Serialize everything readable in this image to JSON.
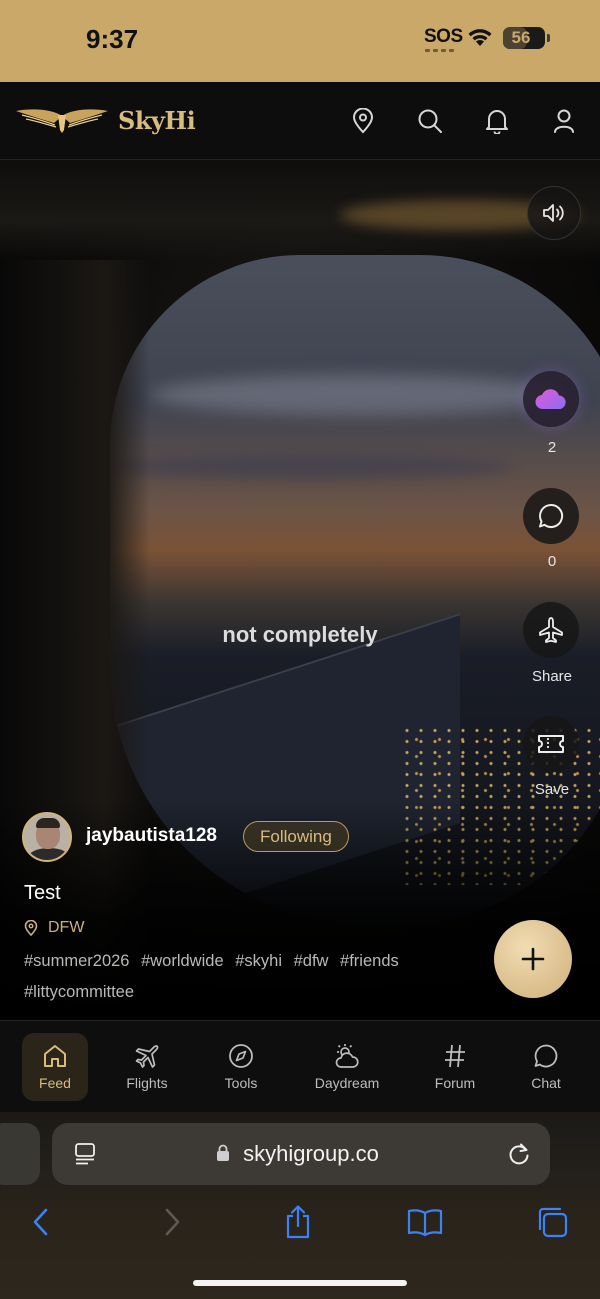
{
  "status_bar": {
    "time": "9:37",
    "sos": "SOS",
    "battery": "56",
    "battery_level_percent": 56,
    "background_color": "#c9a869"
  },
  "header": {
    "brand": "SkyHi",
    "accent_color": "#d9bb7d",
    "icons": [
      "location-pin-icon",
      "search-icon",
      "bell-icon",
      "profile-icon"
    ]
  },
  "video": {
    "overlay_text": "not completely",
    "mute_icon": "speaker-icon"
  },
  "actions": {
    "like_count": "2",
    "comment_count": "0",
    "share_label": "Share",
    "save_label": "Save"
  },
  "post": {
    "username": "jaybautista128",
    "follow_status": "Following",
    "title": "Test",
    "location": "DFW",
    "tags": [
      "#summer2026",
      "#worldwide",
      "#skyhi",
      "#dfw",
      "#friends",
      "#littycommittee"
    ]
  },
  "bottom_nav": {
    "items": [
      {
        "label": "Feed",
        "icon": "home-icon",
        "active": true
      },
      {
        "label": "Flights",
        "icon": "plane-icon",
        "active": false
      },
      {
        "label": "Tools",
        "icon": "compass-icon",
        "active": false
      },
      {
        "label": "Daydream",
        "icon": "sun-cloud-icon",
        "active": false
      },
      {
        "label": "Forum",
        "icon": "hash-icon",
        "active": false
      },
      {
        "label": "Chat",
        "icon": "chat-bubble-icon",
        "active": false
      }
    ]
  },
  "browser": {
    "url": "skyhigroup.co",
    "tint_color": "#3b82f6"
  }
}
